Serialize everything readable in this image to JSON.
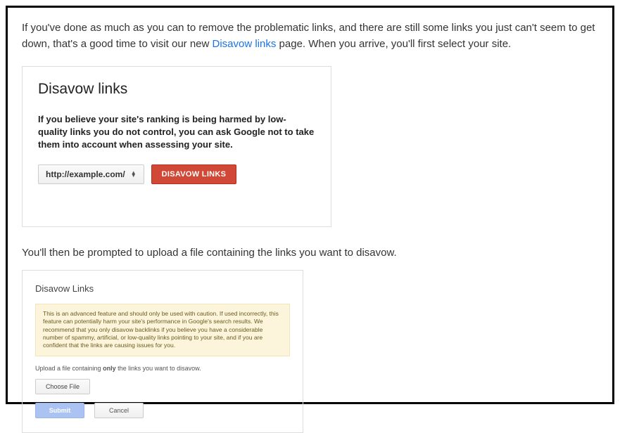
{
  "intro": {
    "before_link": "If you've done as much as you can to remove the problematic links, and there are still some links you just can't seem to get down, that's a good time to visit our new ",
    "link_text": "Disavow links",
    "after_link": " page. When you arrive, you'll first select your site."
  },
  "card1": {
    "title": "Disavow links",
    "description": "If you believe your site's ranking is being harmed by low-quality links you do not control, you can ask Google not to take them into account when assessing your site.",
    "site_selected": "http://example.com/",
    "button": "DISAVOW LINKS"
  },
  "second_intro": "You'll then be prompted to upload a file containing the links you want to disavow.",
  "card2": {
    "title": "Disavow Links",
    "warning": "This is an advanced feature and should only be used with caution. If used incorrectly, this feature can potentially harm your site's performance in Google's search results. We recommend that you only disavow backlinks if you believe you have a considerable number of spammy, artificial, or low-quality links pointing to your site, and if you are confident that the links are causing issues for you.",
    "upload_before": "Upload a file containing ",
    "upload_bold": "only",
    "upload_after": " the links you want to disavow.",
    "choose_file": "Choose File",
    "submit": "Submit",
    "cancel": "Cancel"
  }
}
